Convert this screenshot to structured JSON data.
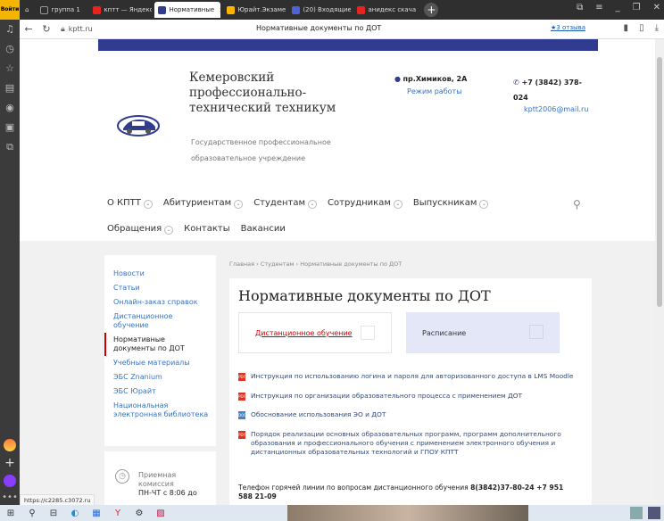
{
  "sidebar": {
    "logo_text": "Войти"
  },
  "tabs": [
    {
      "label": "группа 1",
      "active": false,
      "color": "#555555"
    },
    {
      "label": "кптт — Яндекс:",
      "active": false,
      "color": "#e52620"
    },
    {
      "label": "Нормативные",
      "active": true,
      "color": "#2f3c8f"
    },
    {
      "label": "Юрайт.Экзамен",
      "active": false,
      "color": "#ffb400"
    },
    {
      "label": "(20) Входящие —",
      "active": false,
      "color": "#5060d8"
    },
    {
      "label": "анидекс скачать",
      "active": false,
      "color": "#e52620"
    }
  ],
  "addressbar": {
    "url": "kptt.ru",
    "page_title": "Нормативные документы по ДОТ",
    "reviews": "★3 отзыва"
  },
  "header": {
    "org_name_line1": "Кемеровский",
    "org_name_line2": "профессионально-",
    "org_name_line3": "технический техникум",
    "org_sub_line1": "Государственное профессиональное",
    "org_sub_line2": "образовательное учреждение",
    "address": "пр.Химиков, 2А",
    "hours_link": "Режим работы",
    "phone_line1": "+7 (3842) 378-",
    "phone_line2": "024",
    "email": "kptt2006@mail.ru"
  },
  "mainmenu": {
    "items": [
      "О КПТТ",
      "Абитуриентам",
      "Студентам",
      "Сотрудникам",
      "Выпускникам"
    ],
    "items2": [
      "Обращения",
      "Контакты",
      "Вакансии"
    ]
  },
  "leftmenu": {
    "items": [
      "Новости",
      "Статьи",
      "Онлайн-заказ справок",
      "Дистанционное обучение",
      "Нормативные документы по ДОТ",
      "Учебные материалы",
      "ЭБС Znanium",
      "ЭБС Юрайт",
      "Национальная электронная библиотека"
    ],
    "active_index": 4
  },
  "sidecard": {
    "line1": "Приемная",
    "line2": "комиссия",
    "line3": "ПН-ЧТ с 8:06 до"
  },
  "breadcrumb": {
    "home": "Главная",
    "sep": "›",
    "section": "Студентам",
    "current": "Нормативные документы по ДОТ"
  },
  "content": {
    "title": "Нормативные документы по ДОТ",
    "card1": "Дистанционное обучение",
    "card2": "Расписание",
    "docs": [
      "Инструкция по использованию логина и пароля для авторизованного доступа в LMS Moodle",
      "Инструкция по организации образовательного процесса с применением ДОТ",
      "Обоснование использования ЭО и ДОТ",
      "Порядок реализации основных образовательных программ, программ дополнительного образования и профессионального обучения с применением электронного обучения и дистанционных образовательных технологий и ГПОУ КПТТ"
    ],
    "hotline_text": "Телефон горячей линии по вопросам дистанционного обучения",
    "hotline_phones": "8(3842)37-80-24 +7 951 588 21-09"
  },
  "statusbar": {
    "text": "https://c2285.c3072.ru"
  },
  "colors": {
    "brand": "#2f3c8f",
    "link": "#3a73c0",
    "accent_red": "#cc0000"
  }
}
